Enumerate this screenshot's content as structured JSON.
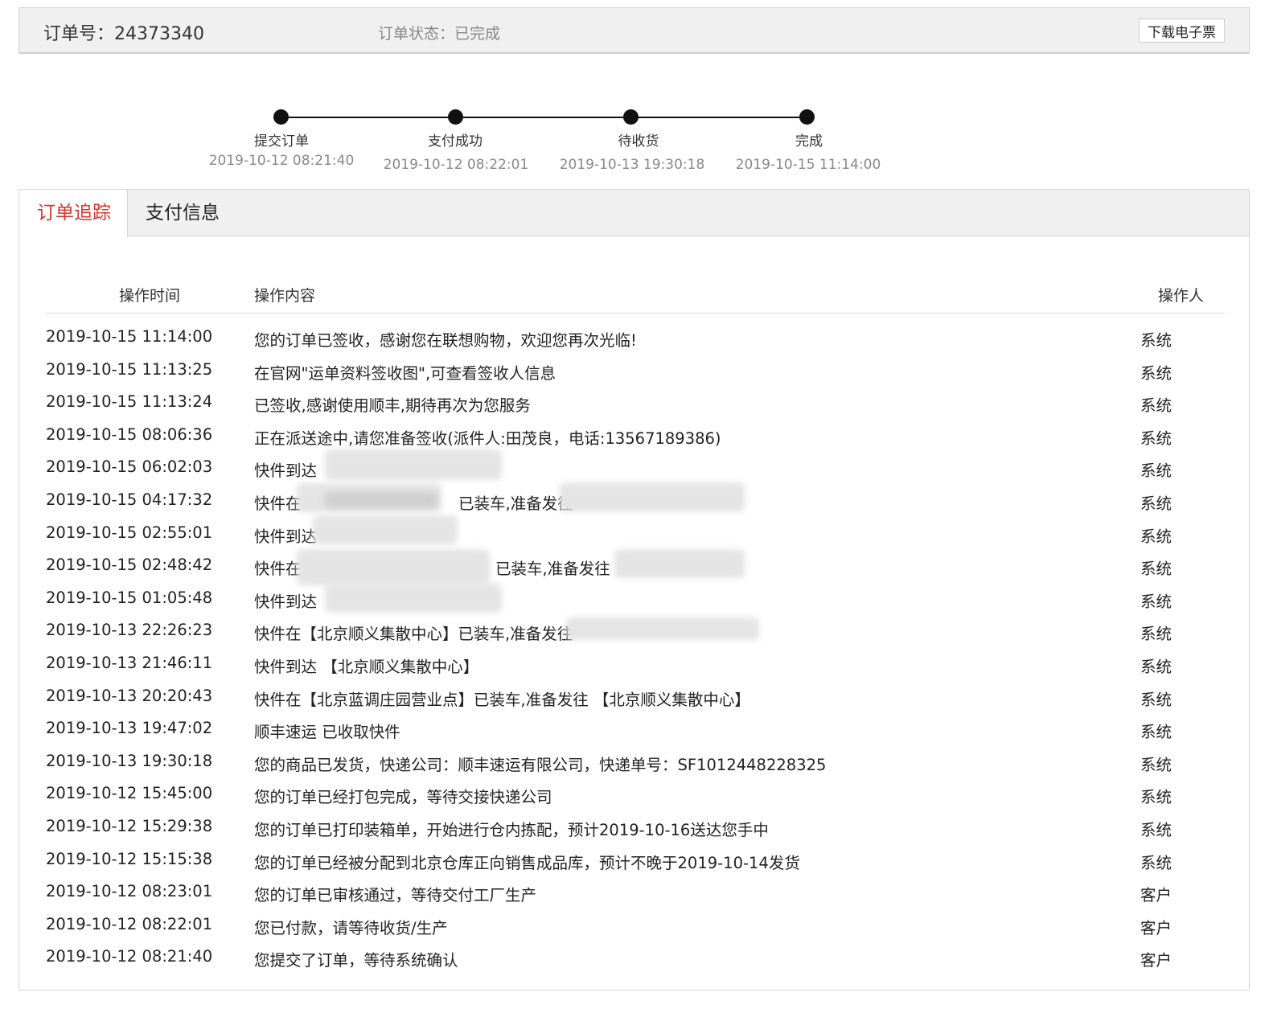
{
  "header": {
    "order_no": "订单号：24373340",
    "status": "订单状态：已完成",
    "download_label": "下载电子票"
  },
  "progress": {
    "steps": [
      {
        "label": "提交订单",
        "time": "2019-10-12 08:21:40"
      },
      {
        "label": "支付成功",
        "time": "2019-10-12 08:22:01"
      },
      {
        "label": "待收货",
        "time": "2019-10-13 19:30:18"
      },
      {
        "label": "完成",
        "time": "2019-10-15 11:14:00"
      }
    ]
  },
  "tabs": [
    {
      "label": "订单追踪",
      "active": true
    },
    {
      "label": "支付信息",
      "active": false
    }
  ],
  "table": {
    "headers": {
      "time": "操作时间",
      "content": "操作内容",
      "operator": "操作人"
    },
    "rows": [
      {
        "time": "2019-10-15 11:14:00",
        "content": "您的订单已签收，感谢您在联想购物，欢迎您再次光临!",
        "operator": "系统"
      },
      {
        "time": "2019-10-15 11:13:25",
        "content": "在官网\"运单资料签收图\",可查看签收人信息",
        "operator": "系统"
      },
      {
        "time": "2019-10-15 11:13:24",
        "content": "已签收,感谢使用顺丰,期待再次为您服务",
        "operator": "系统"
      },
      {
        "time": "2019-10-15 08:06:36",
        "content": "正在派送途中,请您准备签收(派件人:田茂良，电话:13567189386)",
        "operator": "系统"
      },
      {
        "time": "2019-10-15 06:02:03",
        "content": "快件到达",
        "operator": "系统"
      },
      {
        "time": "2019-10-15 04:17:32",
        "content": "快件在",
        "operator": "系统",
        "extra": "已装车,准备发往"
      },
      {
        "time": "2019-10-15 02:55:01",
        "content": "快件到达",
        "operator": "系统"
      },
      {
        "time": "2019-10-15 02:48:42",
        "content": "快件在",
        "operator": "系统",
        "extra": "已装车,准备发往"
      },
      {
        "time": "2019-10-15 01:05:48",
        "content": "快件到达",
        "operator": "系统"
      },
      {
        "time": "2019-10-13 22:26:23",
        "content": "快件在【北京顺义集散中心】已装车,准备发往",
        "operator": "系统"
      },
      {
        "time": "2019-10-13 21:46:11",
        "content": "快件到达 【北京顺义集散中心】",
        "operator": "系统"
      },
      {
        "time": "2019-10-13 20:20:43",
        "content": "快件在【北京蓝调庄园营业点】已装车,准备发往 【北京顺义集散中心】",
        "operator": "系统"
      },
      {
        "time": "2019-10-13 19:47:02",
        "content": "顺丰速运 已收取快件",
        "operator": "系统"
      },
      {
        "time": "2019-10-13 19:30:18",
        "content": "您的商品已发货，快递公司：顺丰速运有限公司，快递单号：SF1012448228325",
        "operator": "系统"
      },
      {
        "time": "2019-10-12 15:45:00",
        "content": "您的订单已经打包完成，等待交接快递公司",
        "operator": "系统"
      },
      {
        "time": "2019-10-12 15:29:38",
        "content": "您的订单已打印装箱单，开始进行仓内拣配，预计2019-10-16送达您手中",
        "operator": "系统"
      },
      {
        "time": "2019-10-12 15:15:38",
        "content": "您的订单已经被分配到北京仓库正向销售成品库，预计不晚于2019-10-14发货",
        "operator": "系统"
      },
      {
        "time": "2019-10-12 08:23:01",
        "content": "您的订单已审核通过，等待交付工厂生产",
        "operator": "客户"
      },
      {
        "time": "2019-10-12 08:22:01",
        "content": "您已付款，请等待收货/生产",
        "operator": "客户"
      },
      {
        "time": "2019-10-12 08:21:40",
        "content": "您提交了订单，等待系统确认",
        "operator": "客户"
      }
    ]
  }
}
